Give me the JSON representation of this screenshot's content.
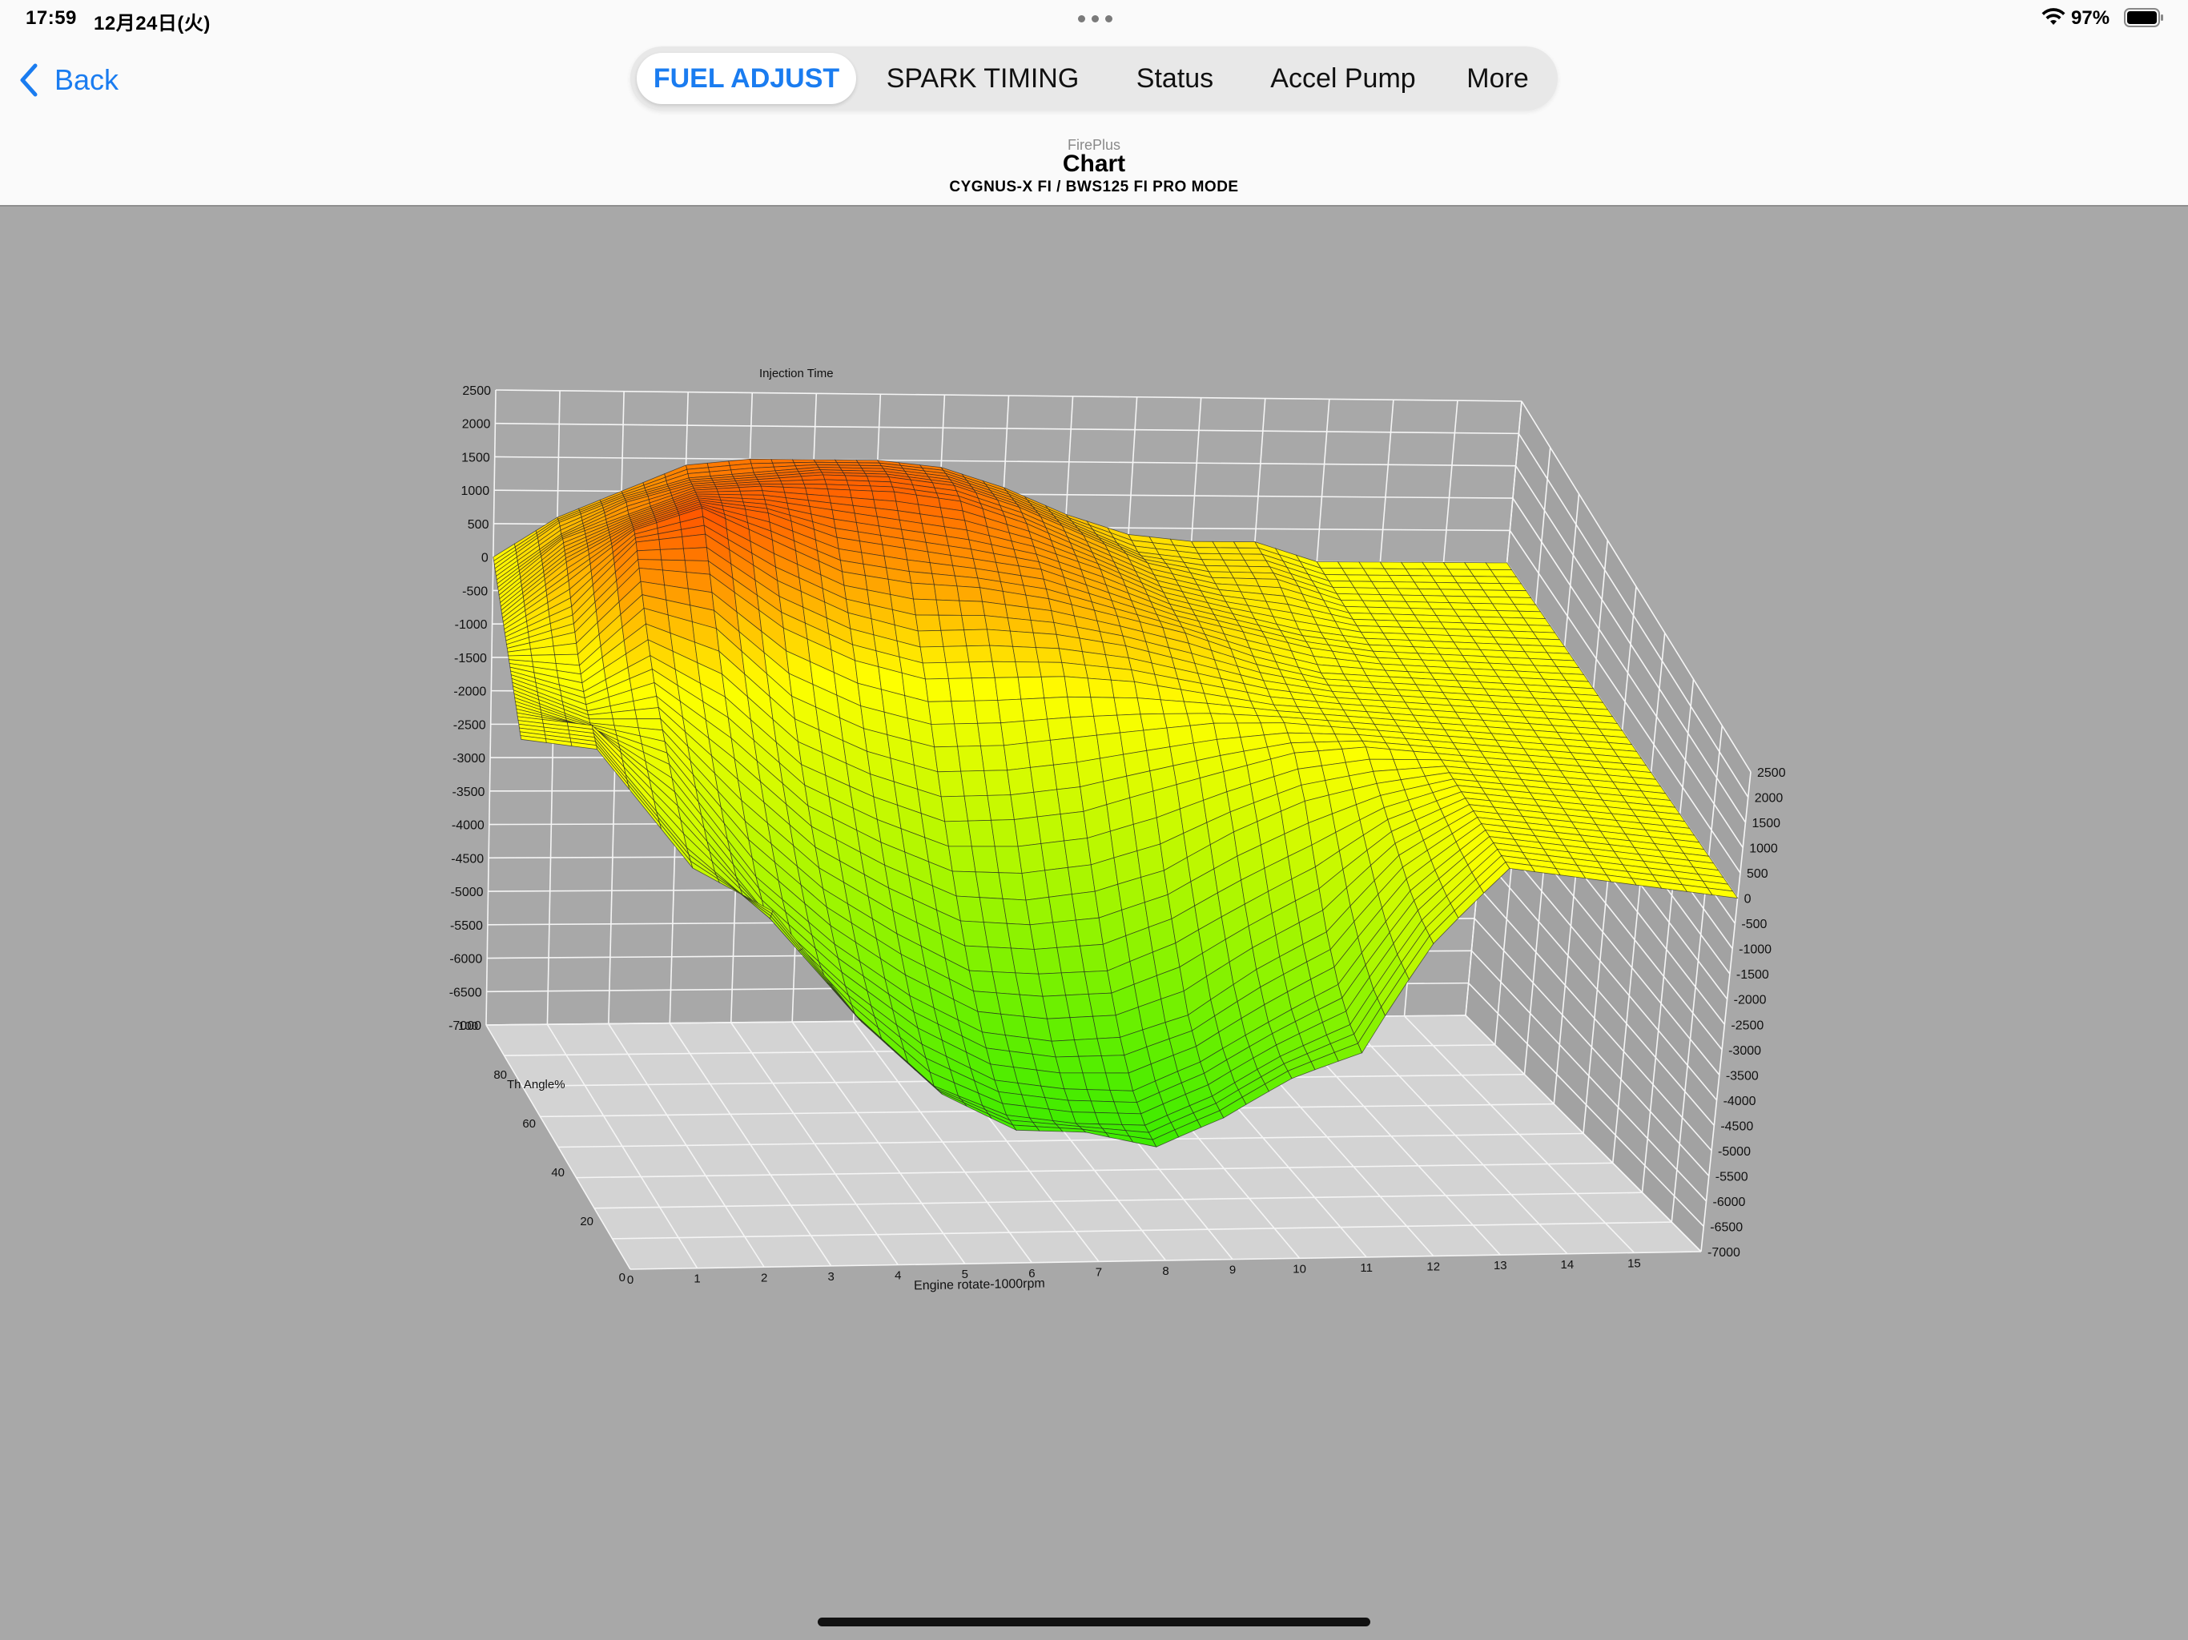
{
  "status_bar": {
    "time": "17:59",
    "date": "12月24日(火)",
    "battery": "97%"
  },
  "nav": {
    "back_label": "Back",
    "app_name": "FirePlus",
    "title": "Chart",
    "subtitle": "CYGNUS-X FI / BWS125 FI PRO MODE"
  },
  "tabs": [
    {
      "label": "FUEL ADJUST",
      "active": true
    },
    {
      "label": "SPARK TIMING",
      "active": false
    },
    {
      "label": "Status",
      "active": false
    },
    {
      "label": "Accel Pump",
      "active": false
    },
    {
      "label": "More",
      "active": false
    }
  ],
  "colors": {
    "accent": "#1a7cf0",
    "surface_low": "#33ee00",
    "surface_mid": "#ffff00",
    "surface_high": "#ff5000"
  },
  "chart_data": {
    "type": "surface",
    "title": "Injection Time",
    "xlabel": "Engine rotate-1000rpm",
    "ylabel": "Th Angle%",
    "x_ticks": [
      0,
      1,
      2,
      3,
      4,
      5,
      6,
      7,
      8,
      9,
      10,
      11,
      12,
      13,
      14,
      15
    ],
    "y_ticks": [
      20,
      40,
      60,
      80,
      100
    ],
    "z_ticks": [
      2500,
      2000,
      1500,
      1000,
      500,
      0,
      -500,
      -1000,
      -1500,
      -2000,
      -2500,
      -3000,
      -3500,
      -4000,
      -4500,
      -5000,
      -5500,
      -6000,
      -6500,
      -7000
    ],
    "xlim": [
      0,
      16
    ],
    "ylim": [
      0,
      100
    ],
    "zlim": [
      -7000,
      2500
    ],
    "grid": true,
    "x": [
      0,
      1,
      2,
      3,
      4,
      5,
      6,
      7,
      8,
      9,
      10,
      11,
      12,
      13,
      14,
      15,
      16
    ],
    "y": [
      0,
      6.25,
      12.5,
      18.75,
      25,
      31.25,
      37.5,
      43.75,
      50,
      56.25,
      62.5,
      68.75,
      75,
      81.25,
      87.5,
      93.75,
      100
    ],
    "z": [
      [
        0,
        0,
        -1500,
        -2000,
        -3500,
        -4500,
        -5000,
        -5000,
        -5200,
        -4700,
        -4000,
        -3500,
        -1500,
        0,
        0,
        0,
        0
      ],
      [
        0,
        0,
        -1400,
        -2300,
        -3600,
        -4600,
        -5000,
        -5100,
        -5100,
        -4600,
        -3900,
        -3300,
        -1400,
        0,
        0,
        0,
        0
      ],
      [
        0,
        0,
        -1000,
        -2400,
        -3400,
        -4200,
        -4700,
        -4800,
        -4800,
        -4300,
        -3600,
        -2900,
        -1200,
        0,
        0,
        0,
        0
      ],
      [
        0,
        -200,
        -600,
        -2100,
        -3000,
        -3700,
        -4200,
        -4300,
        -4200,
        -3800,
        -3000,
        -2300,
        -900,
        0,
        0,
        0,
        0
      ],
      [
        0,
        -300,
        -300,
        -1500,
        -2400,
        -3000,
        -3500,
        -3500,
        -3400,
        -2900,
        -2200,
        -1500,
        -600,
        0,
        0,
        0,
        0
      ],
      [
        0,
        -300,
        0,
        -800,
        -1700,
        -2200,
        -2600,
        -2600,
        -2400,
        -2000,
        -1300,
        -700,
        -300,
        0,
        0,
        0,
        0
      ],
      [
        0,
        -200,
        400,
        -100,
        -1000,
        -1400,
        -1700,
        -1600,
        -1400,
        -1000,
        -600,
        -200,
        0,
        0,
        0,
        0,
        0
      ],
      [
        0,
        0,
        900,
        700,
        -200,
        -600,
        -800,
        -700,
        -500,
        -300,
        -100,
        0,
        0,
        0,
        0,
        0,
        0
      ],
      [
        0,
        300,
        1300,
        1300,
        600,
        200,
        0,
        100,
        200,
        200,
        100,
        0,
        0,
        0,
        0,
        0,
        0
      ],
      [
        0,
        500,
        1500,
        1700,
        1100,
        700,
        500,
        600,
        600,
        500,
        300,
        100,
        0,
        0,
        0,
        0,
        0
      ],
      [
        0,
        700,
        1500,
        1900,
        1500,
        1100,
        1000,
        1000,
        900,
        700,
        500,
        200,
        0,
        0,
        0,
        0,
        0
      ],
      [
        0,
        800,
        1400,
        1800,
        1700,
        1400,
        1300,
        1200,
        1100,
        800,
        500,
        300,
        100,
        0,
        0,
        0,
        0
      ],
      [
        0,
        800,
        1300,
        1700,
        1700,
        1600,
        1500,
        1400,
        1200,
        900,
        500,
        300,
        100,
        0,
        0,
        0,
        0
      ],
      [
        0,
        800,
        1200,
        1600,
        1700,
        1700,
        1700,
        1600,
        1300,
        900,
        500,
        300,
        200,
        0,
        0,
        0,
        0
      ],
      [
        0,
        700,
        1200,
        1500,
        1600,
        1700,
        1700,
        1600,
        1300,
        900,
        500,
        300,
        300,
        0,
        0,
        0,
        0
      ],
      [
        0,
        700,
        1100,
        1400,
        1500,
        1600,
        1600,
        1500,
        1200,
        800,
        400,
        300,
        300,
        0,
        0,
        0,
        0
      ],
      [
        0,
        600,
        1000,
        1400,
        1500,
        1500,
        1500,
        1400,
        1100,
        700,
        400,
        300,
        300,
        0,
        0,
        0,
        0
      ]
    ]
  }
}
